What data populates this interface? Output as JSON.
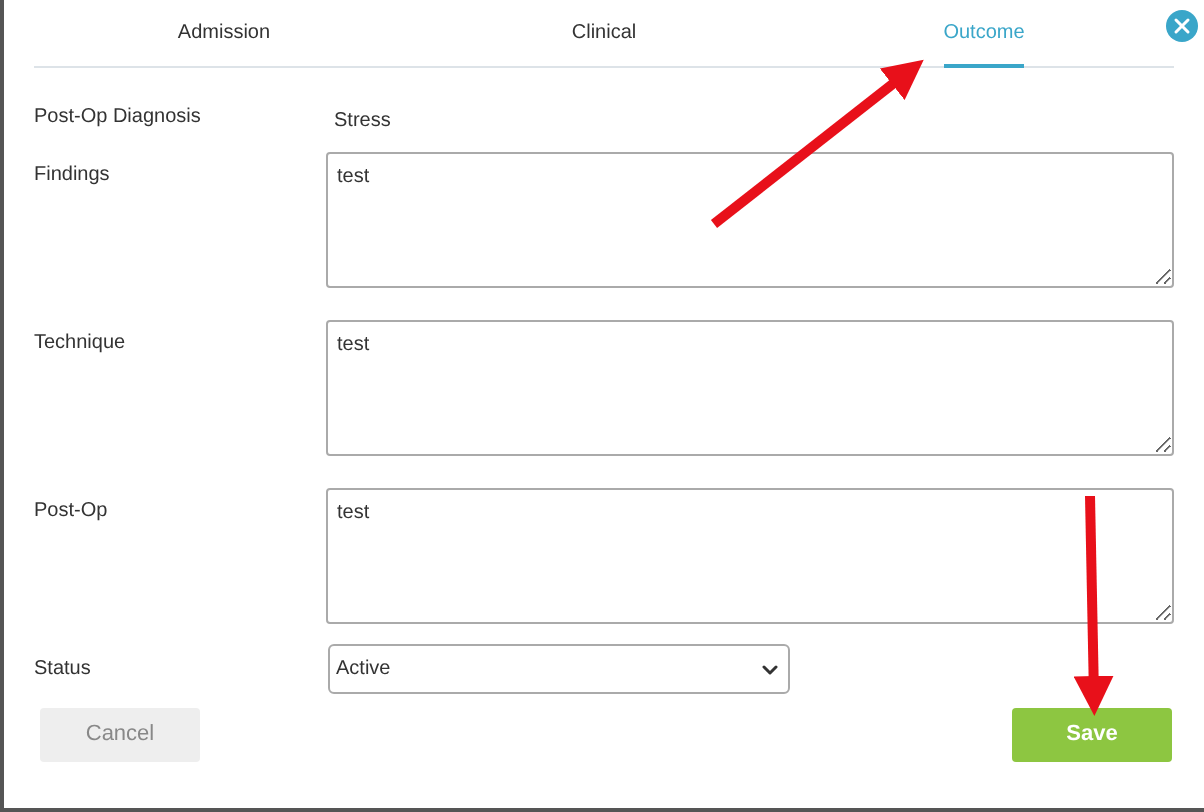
{
  "tabs": [
    {
      "label": "Admission",
      "selected": false
    },
    {
      "label": "Clinical",
      "selected": false
    },
    {
      "label": "Outcome",
      "selected": true
    }
  ],
  "fields": [
    {
      "kind": "text",
      "label": "Post-Op Diagnosis",
      "value": "Stress"
    },
    {
      "kind": "textarea",
      "label": "Findings",
      "value": "test"
    },
    {
      "kind": "textarea",
      "label": "Technique",
      "value": "test"
    },
    {
      "kind": "textarea",
      "label": "Post-Op",
      "value": "test"
    },
    {
      "kind": "select",
      "label": "Status",
      "value": "Active"
    }
  ],
  "buttons": {
    "cancel": "Cancel",
    "save": "Save"
  }
}
